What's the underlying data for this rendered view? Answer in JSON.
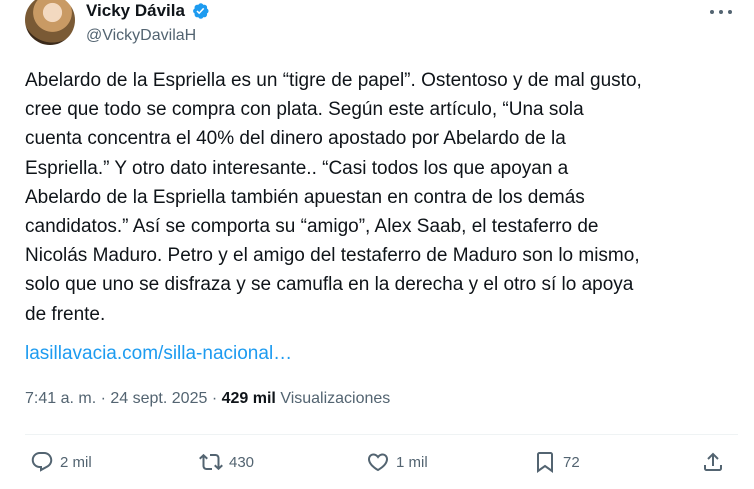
{
  "author": {
    "display_name": "Vicky Dávila",
    "handle": "@VickyDavilaH",
    "verified_color": "#1d9bf0"
  },
  "icons": {
    "more": "more-icon",
    "reply": "reply-icon",
    "repost": "repost-icon",
    "like": "heart-icon",
    "bookmark": "bookmark-icon",
    "share": "share-icon"
  },
  "tweet": {
    "text": "Abelardo de la Espriella es un “tigre de papel”. Ostentoso y de mal gusto,\ncree que todo se compra con plata. Según este artículo, “Una sola\ncuenta concentra el 40% del dinero apostado por Abelardo de la\nEspriella.” Y otro dato interesante.. “Casi todos los que apoyan a\nAbelardo de la Espriella también apuestan en contra de los demás\ncandidatos.” Así se comporta su “amigo”, Alex Saab, el testaferro de\nNicolás Maduro. Petro y el amigo del testaferro de Maduro son lo mismo,\nsolo que uno se disfraza y se camufla en la derecha y el otro sí lo apoya\nde frente.",
    "link": "lasillavacia.com/silla-nacional…"
  },
  "meta": {
    "time": "7:41 a. m.",
    "separator": "·",
    "date": "24 sept. 2025",
    "views_count": "429 mil",
    "views_label": "Visualizaciones"
  },
  "actions": {
    "replies": "2 mil",
    "reposts": "430",
    "likes": "1 mil",
    "bookmarks": "72"
  }
}
